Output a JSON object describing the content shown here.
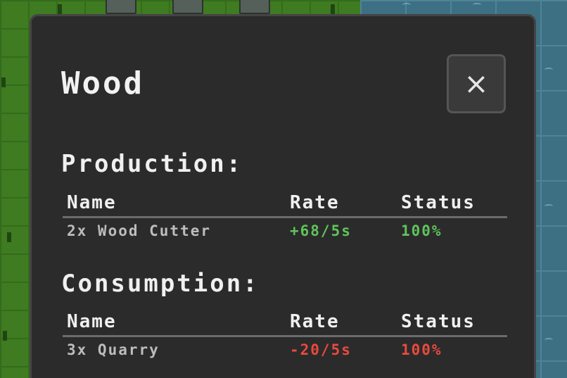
{
  "panel": {
    "title": "Wood",
    "close_icon": "close-icon",
    "close_glyph": "×"
  },
  "production": {
    "heading": "Production:",
    "columns": [
      "Name",
      "Rate",
      "Status"
    ],
    "rows": [
      {
        "name": "2x Wood Cutter",
        "rate": "+68/5s",
        "status": "100%"
      }
    ]
  },
  "consumption": {
    "heading": "Consumption:",
    "columns": [
      "Name",
      "Rate",
      "Status"
    ],
    "rows": [
      {
        "name": "3x Quarry",
        "rate": "-20/5s",
        "status": "100%"
      }
    ]
  },
  "colors": {
    "positive": "#5fc45a",
    "negative": "#ea4a3c",
    "panel_bg": "#2b2b2c",
    "grass": "#3f7b21",
    "water": "#3d7083"
  }
}
